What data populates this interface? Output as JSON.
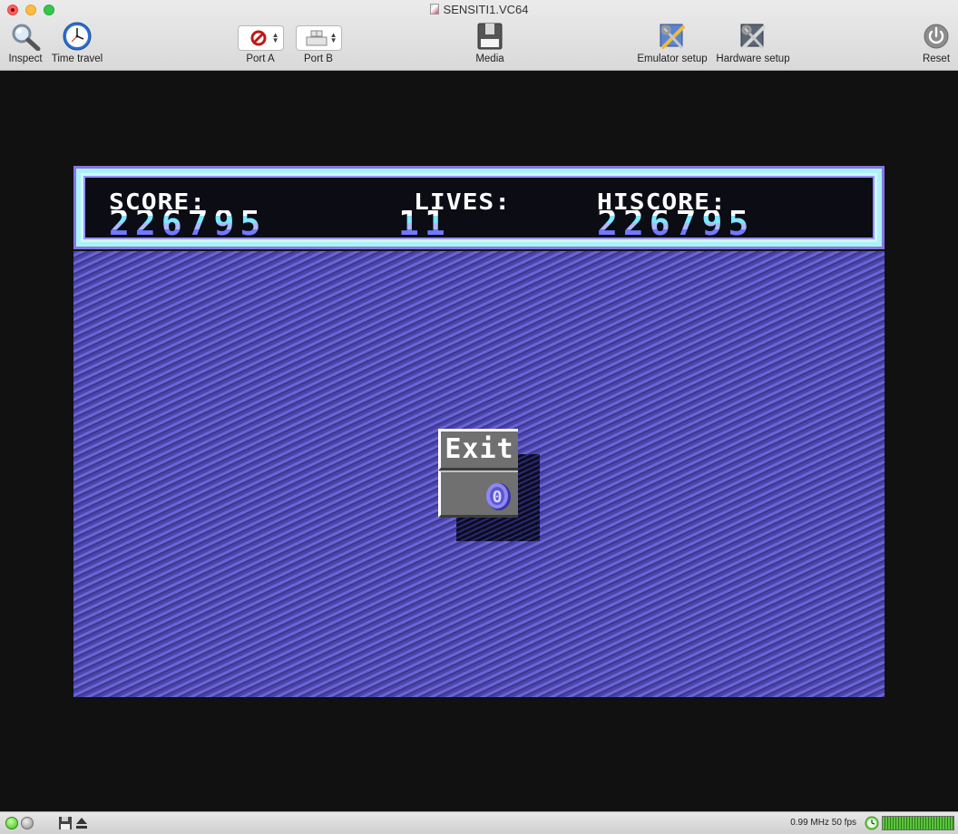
{
  "window": {
    "title": "SENSITI1.VC64"
  },
  "toolbar": {
    "inspect_label": "Inspect",
    "time_travel_label": "Time travel",
    "port_a_label": "Port A",
    "port_b_label": "Port B",
    "media_label": "Media",
    "emulator_setup_label": "Emulator setup",
    "hardware_setup_label": "Hardware setup",
    "reset_label": "Reset"
  },
  "game": {
    "score_label": "SCORE:",
    "score_value": "226795",
    "lives_label": "LIVES:",
    "lives_value": "11",
    "hiscore_label": "HISCORE:",
    "hiscore_value": "226795",
    "exit_label": "Exit",
    "exit_count": "0"
  },
  "statusbar": {
    "speed_text": "0.99 MHz 50 fps"
  },
  "colors": {
    "playfield": "#5953c0",
    "hud_border": "#8777e0",
    "screen_border": "#111111"
  },
  "icons": [
    "magnifier-icon",
    "clock-icon",
    "no-device-icon",
    "keyboard-icon",
    "floppy-drive-icon",
    "emulator-setup-icon",
    "hardware-setup-icon",
    "power-icon",
    "disk-icon",
    "eject-icon",
    "speed-clock-icon"
  ]
}
